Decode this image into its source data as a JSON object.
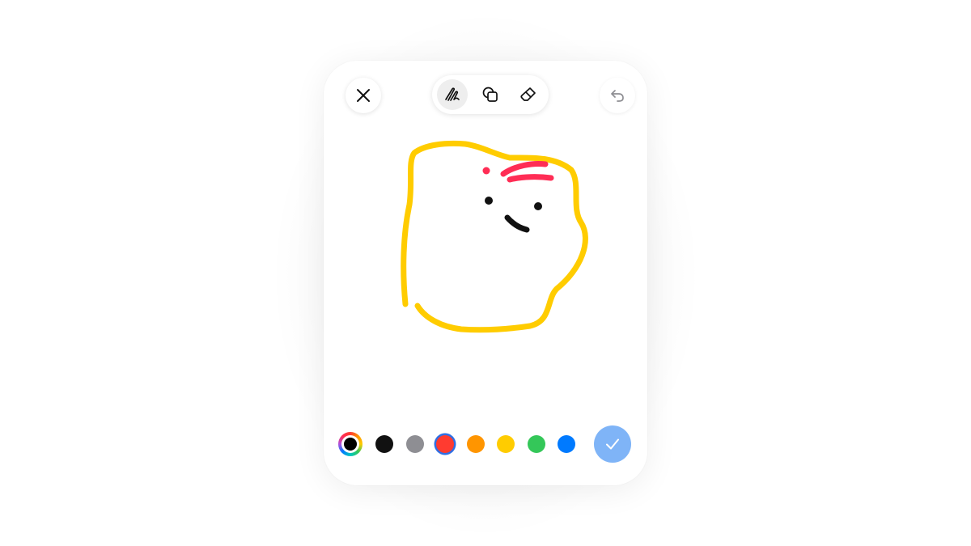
{
  "header": {
    "close_icon": "close-icon",
    "undo_icon": "undo-icon"
  },
  "toolbar": {
    "tools": [
      {
        "name": "pen",
        "icon": "pen-scribble-icon",
        "active": true
      },
      {
        "name": "shapes",
        "icon": "shapes-icon",
        "active": false
      },
      {
        "name": "eraser",
        "icon": "eraser-icon",
        "active": false
      }
    ]
  },
  "palette": {
    "colors": [
      "#111111",
      "#8e8e93",
      "#ff3b30",
      "#ff9500",
      "#ffcc00",
      "#34c759",
      "#007aff"
    ],
    "selected_color": "#ff3b30",
    "picker_icon": "color-wheel-icon"
  },
  "drawing": {
    "stroke_colors": {
      "outline": "#ffcc00",
      "accent": "#ff2d55",
      "face": "#111111"
    }
  },
  "done": {
    "icon": "checkmark-icon",
    "color": "#7fb4f7"
  }
}
